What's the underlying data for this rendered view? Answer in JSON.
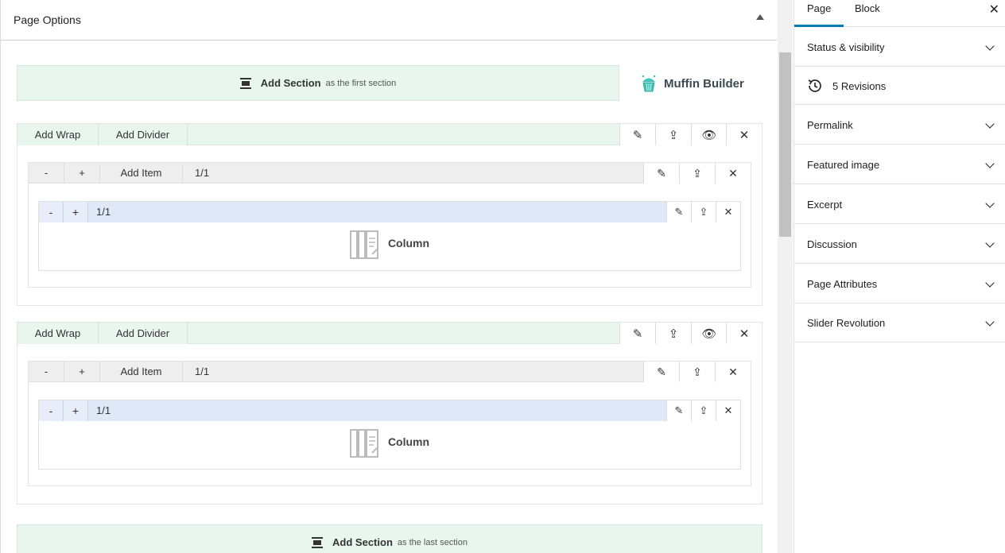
{
  "page_options": {
    "title": "Page Options"
  },
  "builder": {
    "add_first": {
      "label": "Add Section",
      "suffix": "as the first section"
    },
    "add_last": {
      "label": "Add Section",
      "suffix": "as the last section"
    },
    "brand": "Muffin Builder",
    "sections": [
      {
        "add_wrap": "Add Wrap",
        "add_divider": "Add Divider",
        "wrap": {
          "minus": "-",
          "plus": "+",
          "add_item": "Add Item",
          "size": "1/1",
          "column": {
            "minus": "-",
            "plus": "+",
            "size": "1/1",
            "label": "Column"
          }
        }
      },
      {
        "add_wrap": "Add Wrap",
        "add_divider": "Add Divider",
        "wrap": {
          "minus": "-",
          "plus": "+",
          "add_item": "Add Item",
          "size": "1/1",
          "column": {
            "minus": "-",
            "plus": "+",
            "size": "1/1",
            "label": "Column"
          }
        }
      }
    ]
  },
  "sidebar": {
    "tabs": [
      {
        "label": "Page",
        "active": true
      },
      {
        "label": "Block",
        "active": false
      }
    ],
    "close": "✕",
    "panels": {
      "status": "Status & visibility",
      "revisions": "5 Revisions",
      "permalink": "Permalink",
      "featured_image": "Featured image",
      "excerpt": "Excerpt",
      "discussion": "Discussion",
      "page_attributes": "Page Attributes",
      "slider_revolution": "Slider Revolution"
    }
  },
  "colors": {
    "accent": "#007cba",
    "section_bar": "#e8f6ee",
    "column_bar": "#dfe8f6",
    "brand": "#3cc4b4"
  }
}
